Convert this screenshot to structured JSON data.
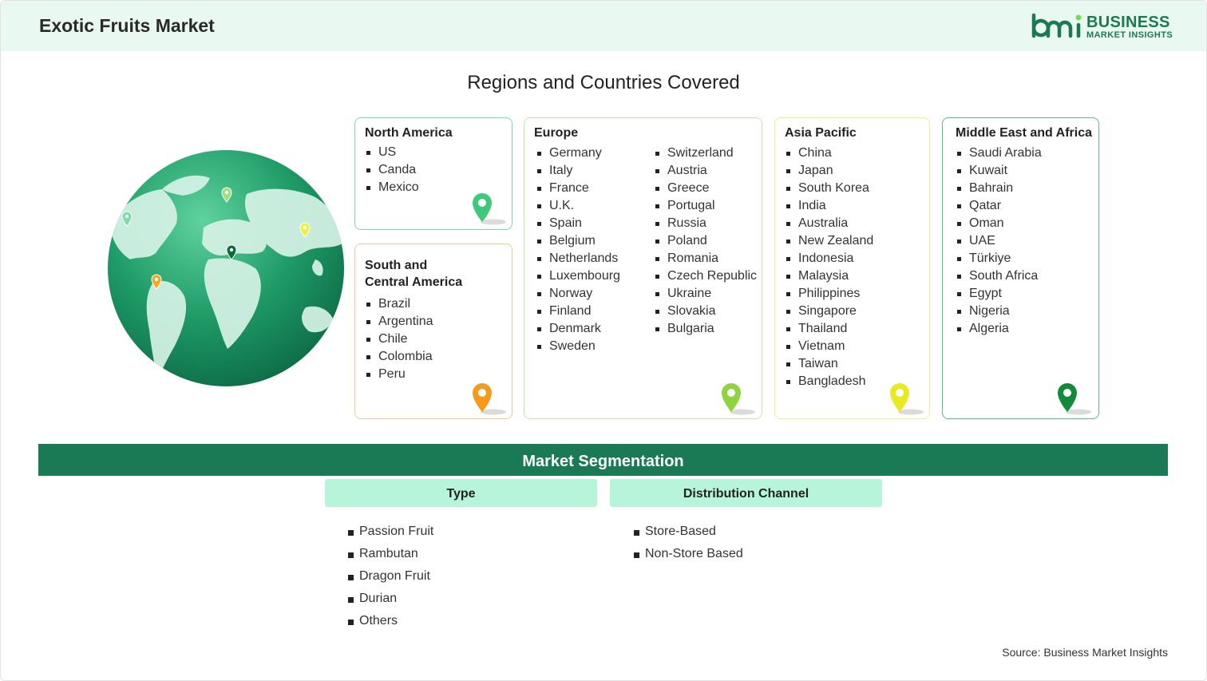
{
  "header": {
    "title": "Exotic Fruits Market"
  },
  "logo": {
    "line1": "BUSINESS",
    "line2": "MARKET INSIGHTS"
  },
  "regions": {
    "title": "Regions and Countries Covered",
    "north_america": {
      "name": "North America",
      "countries": [
        "US",
        "Canda",
        "Mexico"
      ]
    },
    "south_america": {
      "name_line1": "South and",
      "name_line2": "Central America",
      "countries": [
        "Brazil",
        "Argentina",
        "Chile",
        "Colombia",
        "Peru"
      ]
    },
    "europe": {
      "name": "Europe",
      "col1": [
        "Germany",
        "Italy",
        "France",
        "U.K.",
        "Spain",
        "Belgium",
        "Netherlands",
        "Luxembourg",
        "Norway",
        "Finland",
        "Denmark",
        "Sweden"
      ],
      "col2": [
        "Switzerland",
        "Austria",
        "Greece",
        "Portugal",
        "Russia",
        "Poland",
        "Romania",
        "Czech Republic",
        "Ukraine",
        "Slovakia",
        "Bulgaria"
      ]
    },
    "asia_pacific": {
      "name": "Asia Pacific",
      "countries": [
        "China",
        "Japan",
        "South Korea",
        "India",
        "Australia",
        "New Zealand",
        "Indonesia",
        "Malaysia",
        "Philippines",
        "Singapore",
        "Thailand",
        "Vietnam",
        "Taiwan",
        "Bangladesh"
      ]
    },
    "mea": {
      "name": "Middle East and Africa",
      "countries": [
        "Saudi Arabia",
        "Kuwait",
        "Bahrain",
        "Qatar",
        "Oman",
        "UAE",
        "Türkiye",
        "South Africa",
        "Egypt",
        "Nigeria",
        "Algeria"
      ]
    }
  },
  "segmentation": {
    "title": "Market Segmentation",
    "type": {
      "heading": "Type",
      "items": [
        "Passion Fruit",
        "Rambutan",
        "Dragon Fruit",
        "Durian",
        "Others"
      ]
    },
    "channel": {
      "heading": "Distribution Channel",
      "items": [
        "Store-Based",
        "Non-Store Based"
      ]
    }
  },
  "source": "Source: Business Market Insights",
  "colors": {
    "brand_green": "#1a7a55",
    "north_america": "#7ddba8",
    "south_america": "#f5c891",
    "europe": "#bfe6a8",
    "asia_pacific": "#eef08a",
    "mea": "#5fb98a"
  }
}
